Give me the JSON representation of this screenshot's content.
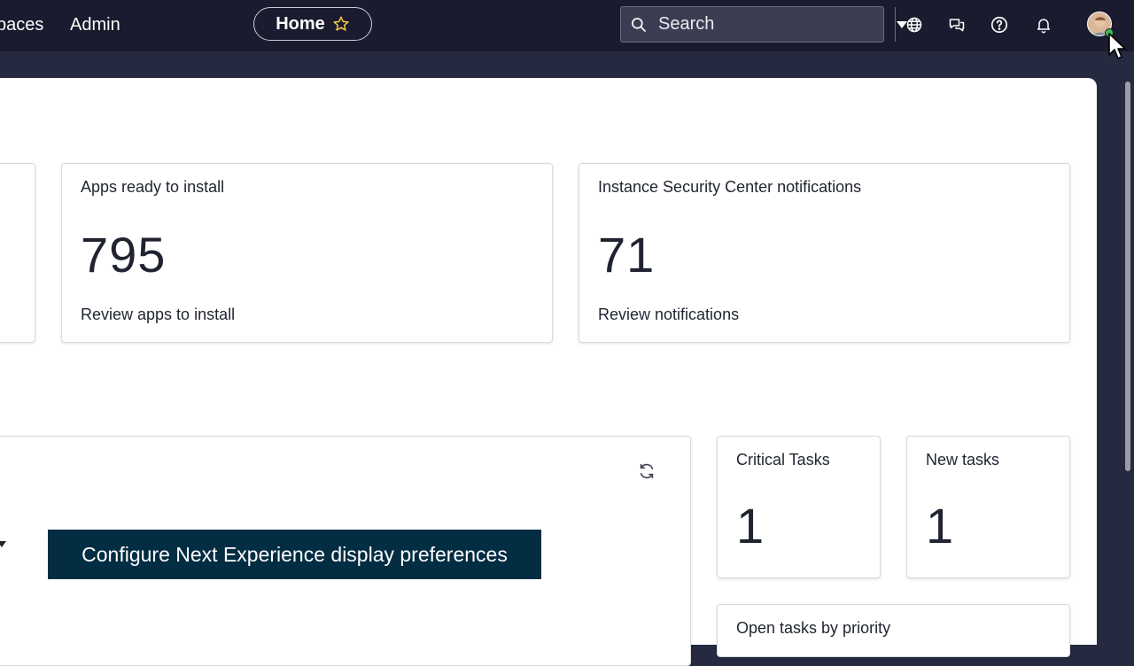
{
  "nav": {
    "workspaces_label": "paces",
    "admin_label": "Admin",
    "home_label": "Home",
    "search_placeholder": "Search"
  },
  "cards": {
    "apps": {
      "title": "Apps ready to install",
      "value": "795",
      "link": "Review apps to install"
    },
    "security": {
      "title": "Instance Security Center notifications",
      "value": "71",
      "link": "Review notifications"
    },
    "critical": {
      "title": "Critical Tasks",
      "value": "1"
    },
    "new_tasks": {
      "title": "New tasks",
      "value": "1"
    },
    "open_tasks": {
      "title": "Open tasks by priority"
    }
  },
  "cta": {
    "label": "Configure Next Experience display preferences"
  },
  "colors": {
    "topbar": "#1a1b2e",
    "cta_bg": "#032d42",
    "star": "#f2c94c"
  },
  "icons": [
    "search-icon",
    "chevron-down-icon",
    "globe-icon",
    "chat-icon",
    "help-icon",
    "bell-icon",
    "star-icon",
    "refresh-icon"
  ]
}
